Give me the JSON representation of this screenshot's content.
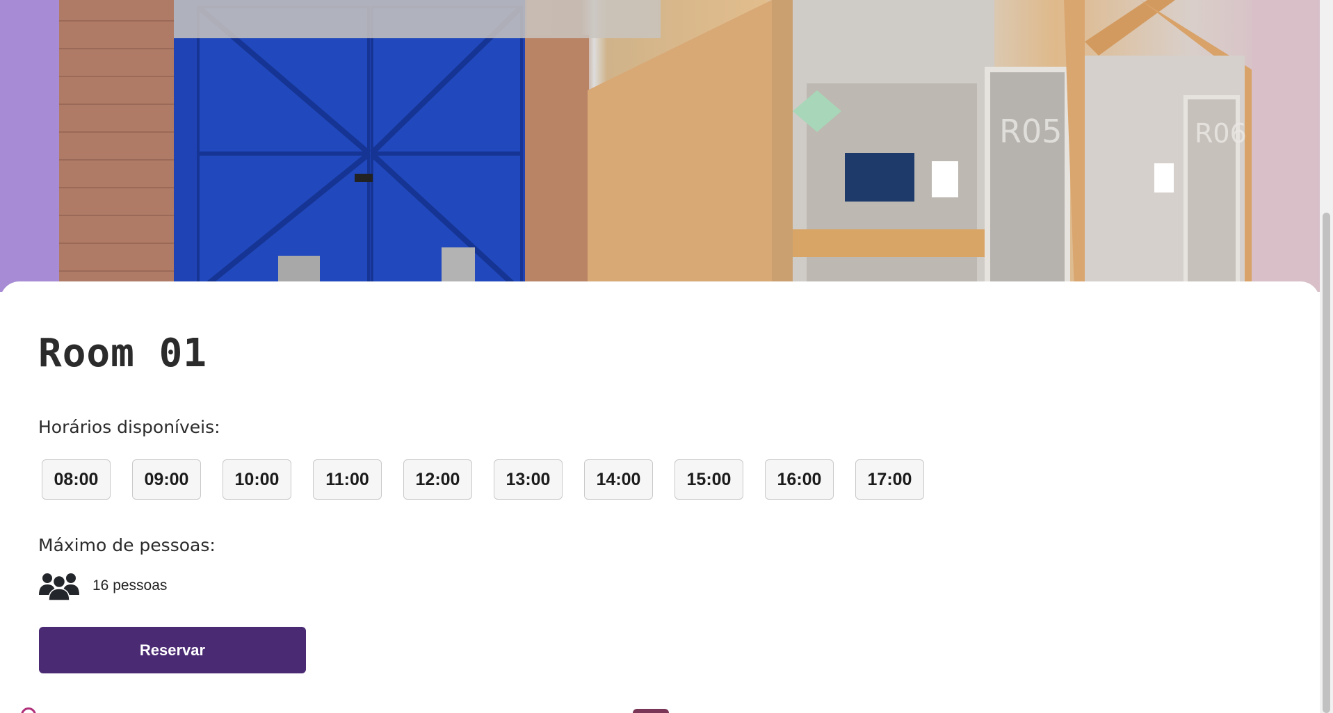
{
  "room": {
    "title": "Room 01",
    "hero_image_alt": ""
  },
  "schedule": {
    "label": "Horários disponíveis:",
    "slots": [
      "08:00",
      "09:00",
      "10:00",
      "11:00",
      "12:00",
      "13:00",
      "14:00",
      "15:00",
      "16:00",
      "17:00"
    ]
  },
  "capacity": {
    "label": "Máximo de pessoas:",
    "icon": "people-group-icon",
    "value_text": "16 pessoas"
  },
  "actions": {
    "reserve_label": "Reservar"
  },
  "colors": {
    "primary": "#4b2a74",
    "slot_bg": "#f6f6f6",
    "slot_border": "#c9c9c9",
    "text": "#2b2b2b"
  }
}
